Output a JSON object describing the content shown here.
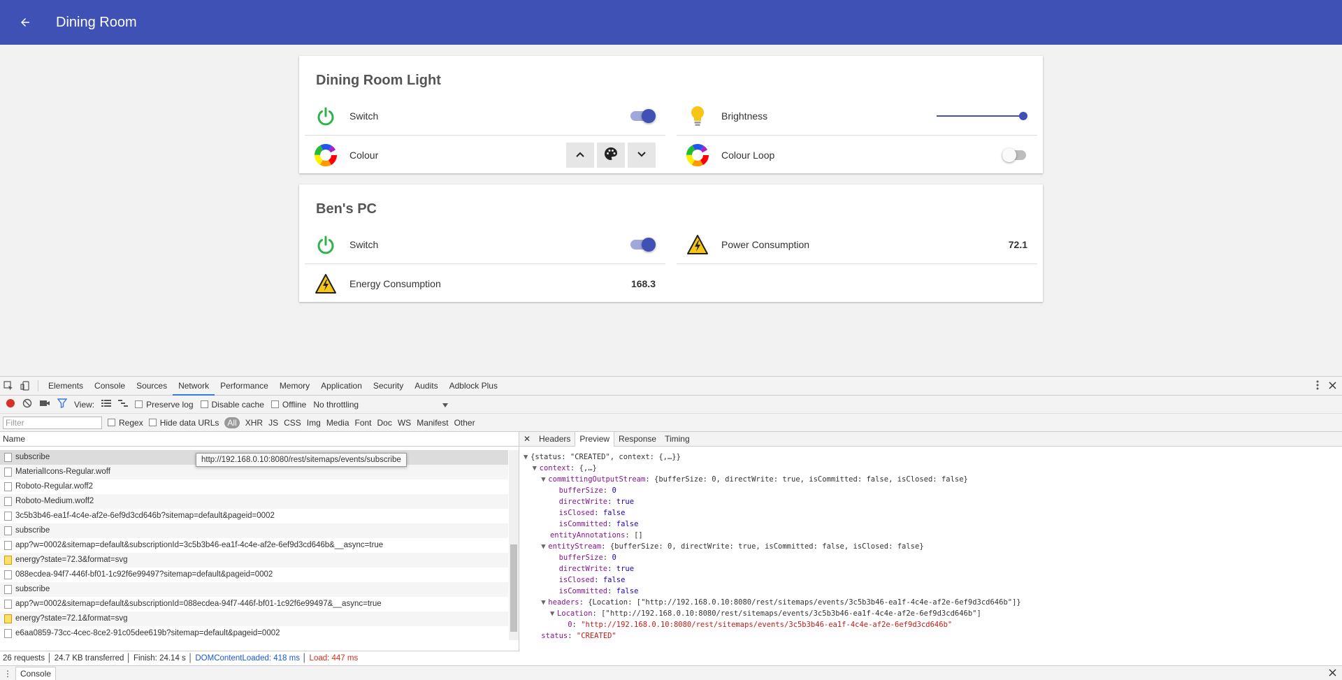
{
  "appbar": {
    "title": "Dining Room"
  },
  "cards": {
    "light": {
      "title": "Dining Room Light",
      "switch_label": "Switch",
      "brightness_label": "Brightness",
      "brightness_level": 1.0,
      "colour_label": "Colour",
      "colour_loop_label": "Colour Loop"
    },
    "pc": {
      "title": "Ben's PC",
      "switch_label": "Switch",
      "power_label": "Power Consumption",
      "power_value": "72.1",
      "energy_label": "Energy Consumption",
      "energy_value": "168.3"
    }
  },
  "devtools": {
    "tabs": [
      "Elements",
      "Console",
      "Sources",
      "Network",
      "Performance",
      "Memory",
      "Application",
      "Security",
      "Audits",
      "Adblock Plus"
    ],
    "active_tab": "Network",
    "toolbar": {
      "view_label": "View:",
      "preserve_log": "Preserve log",
      "disable_cache": "Disable cache",
      "offline": "Offline",
      "throttling": "No throttling"
    },
    "filter": {
      "placeholder": "Filter",
      "regex": "Regex",
      "hide_data": "Hide data URLs",
      "all": "All",
      "types": [
        "XHR",
        "JS",
        "CSS",
        "Img",
        "Media",
        "Font",
        "Doc",
        "WS",
        "Manifest",
        "Other"
      ]
    },
    "name_header": "Name",
    "requests": [
      {
        "name": "subscribe",
        "warn": false
      },
      {
        "name": "MaterialIcons-Regular.woff",
        "warn": false
      },
      {
        "name": "Roboto-Regular.woff2",
        "warn": false
      },
      {
        "name": "Roboto-Medium.woff2",
        "warn": false
      },
      {
        "name": "3c5b3b46-ea1f-4c4e-af2e-6ef9d3cd646b?sitemap=default&pageid=0002",
        "warn": false
      },
      {
        "name": "subscribe",
        "warn": false
      },
      {
        "name": "app?w=0002&sitemap=default&subscriptionId=3c5b3b46-ea1f-4c4e-af2e-6ef9d3cd646b&__async=true",
        "warn": false
      },
      {
        "name": "energy?state=72.3&format=svg",
        "warn": true
      },
      {
        "name": "088ecdea-94f7-446f-bf01-1c92f6e99497?sitemap=default&pageid=0002",
        "warn": false
      },
      {
        "name": "subscribe",
        "warn": false
      },
      {
        "name": "app?w=0002&sitemap=default&subscriptionId=088ecdea-94f7-446f-bf01-1c92f6e99497&__async=true",
        "warn": false
      },
      {
        "name": "energy?state=72.1&format=svg",
        "warn": true
      },
      {
        "name": "e6aa0859-73cc-4cec-8ce2-91c05dee619b?sitemap=default&pageid=0002",
        "warn": false
      }
    ],
    "tooltip": "http://192.168.0.10:8080/rest/sitemaps/events/subscribe",
    "status": {
      "requests": "26 requests",
      "transferred": "24.7 KB transferred",
      "finish": "Finish: 24.14 s",
      "dom": "DOMContentLoaded: 418 ms",
      "load": "Load: 447 ms"
    },
    "preview_tabs": [
      "Headers",
      "Preview",
      "Response",
      "Timing"
    ],
    "active_preview_tab": "Preview",
    "preview": {
      "l1": "{status: \"CREATED\", context: {,…}}",
      "l2_key": "context",
      "l2_val": "{,…}",
      "l3_key": "committingOutputStream",
      "l3_val": "{bufferSize: 0, directWrite: true, isCommitted: false, isClosed: false}",
      "l4": [
        "bufferSize",
        "0"
      ],
      "l5": [
        "directWrite",
        "true"
      ],
      "l6": [
        "isClosed",
        "false"
      ],
      "l7": [
        "isCommitted",
        "false"
      ],
      "l8": [
        "entityAnnotations",
        "[]"
      ],
      "l9_key": "entityStream",
      "l9_val": "{bufferSize: 0, directWrite: true, isCommitted: false, isClosed: false}",
      "l10": [
        "bufferSize",
        "0"
      ],
      "l11": [
        "directWrite",
        "true"
      ],
      "l12": [
        "isClosed",
        "false"
      ],
      "l13": [
        "isCommitted",
        "false"
      ],
      "l14_key": "headers",
      "l14_val": "{Location: [\"http://192.168.0.10:8080/rest/sitemaps/events/3c5b3b46-ea1f-4c4e-af2e-6ef9d3cd646b\"]}",
      "l15_key": "Location",
      "l15_val": "[\"http://192.168.0.10:8080/rest/sitemaps/events/3c5b3b46-ea1f-4c4e-af2e-6ef9d3cd646b\"]",
      "l16_key": "0",
      "l16_val": "\"http://192.168.0.10:8080/rest/sitemaps/events/3c5b3b46-ea1f-4c4e-af2e-6ef9d3cd646b\"",
      "l17_key": "status",
      "l17_val": "\"CREATED\""
    },
    "console_tab": "Console"
  }
}
